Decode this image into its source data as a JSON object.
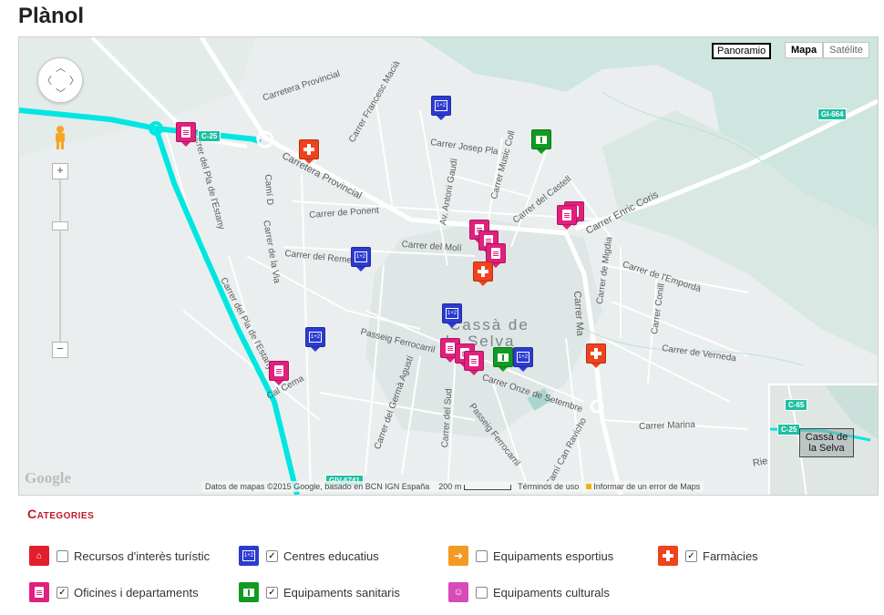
{
  "page": {
    "title": "Plànol"
  },
  "map": {
    "town_label": "Cassà de\nla Selva",
    "town_line1": "Cassà de",
    "town_line2": "la Selva",
    "roads": {
      "carretera_provincial_top": "Carretera Provincial",
      "francesc_macia": "Carrer Francesc Macià",
      "carretera_provincial_diag": "Carretera Provincial",
      "josep_pla": "Carrer Josep Pla",
      "music_coll": "Carrer Music Coll",
      "antoni_gaudi": "Av. Antoni Gaudí",
      "carrer_castell": "Carrer del Castell",
      "enric_coris": "Carrer Enric Coris",
      "pla_estany_top": "Carrer del Pla de l'Estany",
      "cami_d": "Camí D",
      "ponent": "Carrer de Ponent",
      "molt": "Carrer del Molí",
      "rem": "Carrer del Reme",
      "via": "Carrer de la Via",
      "pla_estany_low": "Carrer del Pla de l'Estany",
      "miguia": "Carrer de Migdia",
      "emporda": "Carrer de l'Empordà",
      "conill": "Carrer Conill",
      "carrer_ma": "Carrer Ma",
      "verneda": "Carrer de Verneda",
      "passeig_ferrocarril": "Passeig Ferrocarril",
      "setembre": "Carrer Onze de Setembre",
      "germa_agusti": "Carrer del Germà Agustí",
      "carrer_sud": "Carrer del Sud",
      "passeig_ferrocarril2": "Passeig Ferrocarril",
      "can_ravicho": "Camí Can Ravicho",
      "marina": "Carrer Marina",
      "rie": "Rie",
      "cremat": "Cal Cema"
    },
    "shields": {
      "c25_top": "C-25",
      "gi664": "GI-664",
      "giv6741": "GIV-6741",
      "c65": "C-65",
      "c25_ov": "C-25"
    },
    "controls": {
      "panoramio": "Panoramio",
      "maptype_map": "Mapa",
      "maptype_sat": "Satélite",
      "zoom_in": "+",
      "zoom_out": "−"
    },
    "footer": {
      "data": "Datos de mapas ©2015 Google, basado en BCN IGN España",
      "scale": "200 m",
      "terms": "Términos de uso",
      "report": "Informar de un error de Maps"
    },
    "google_logo": "Google",
    "overview_label": "Cassà de la Selva"
  },
  "categories": {
    "title": "Categories",
    "items": [
      {
        "label": "Recursos d'interès turístic",
        "checked": false,
        "color": "#e21e2c"
      },
      {
        "label": "Centres educatius",
        "checked": true,
        "color": "#2c3bd0"
      },
      {
        "label": "Equipaments esportius",
        "checked": false,
        "color": "#f39a25"
      },
      {
        "label": "Farmàcies",
        "checked": true,
        "color": "#f0421d"
      },
      {
        "label": "Oficines i departaments",
        "checked": true,
        "color": "#e2207d"
      },
      {
        "label": "Equipaments sanitaris",
        "checked": true,
        "color": "#119b22"
      },
      {
        "label": "Equipaments culturals",
        "checked": false,
        "color": "#d74bb8"
      }
    ]
  }
}
